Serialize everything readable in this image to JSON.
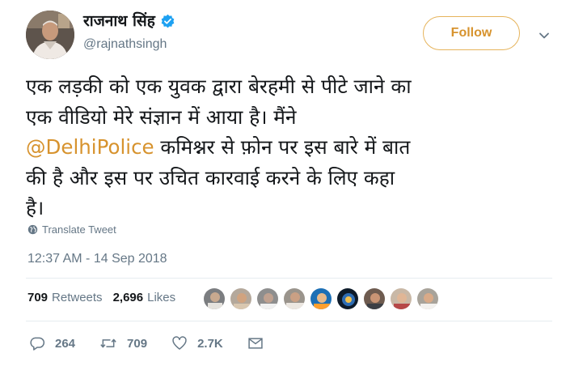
{
  "author": {
    "display_name": "राजनाथ सिंह",
    "handle": "@rajnathsingh",
    "verified": true
  },
  "follow_button": {
    "label": "Follow"
  },
  "tweet": {
    "lines": [
      "एक लड़की को एक युवक द्वारा बेरहमी से पीटे जाने का",
      "एक वीडियो मेरे संज्ञान में आया है। मैंने",
      "@DelhiPolice",
      " कमिश्नर से फ़ोन पर इस बारे में बात",
      "की है और इस पर उचित कारवाई करने के लिए कहा",
      "है।"
    ]
  },
  "translate": {
    "label": "Translate Tweet"
  },
  "timestamp": "12:37 AM - 14 Sep 2018",
  "stats": {
    "retweets_count": "709",
    "retweets_label": "Retweets",
    "likes_count": "2,696",
    "likes_label": "Likes"
  },
  "actions": {
    "reply_count": "264",
    "retweet_count": "709",
    "like_count": "2.7K"
  },
  "colors": {
    "accent": "#d7932e",
    "text": "#14171a",
    "muted": "#657786",
    "divider": "#e6ecf0",
    "verified": "#1da1f2"
  },
  "icons": [
    "verified-badge-icon",
    "chevron-down-icon",
    "globe-icon",
    "reply-icon",
    "retweet-icon",
    "heart-icon",
    "message-icon"
  ]
}
